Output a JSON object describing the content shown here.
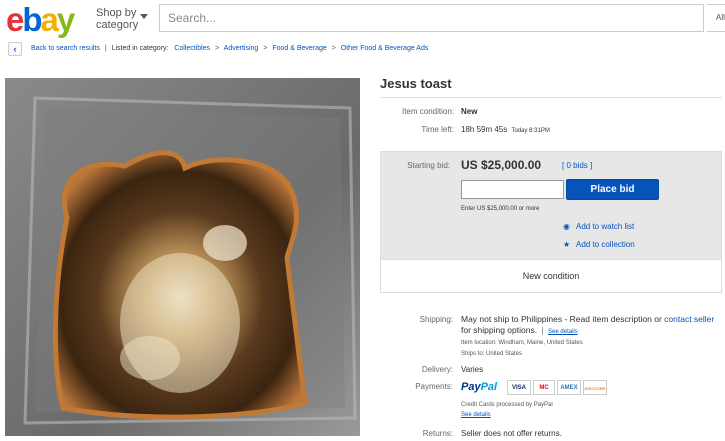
{
  "header": {
    "logo_letters": [
      "e",
      "b",
      "a",
      "y"
    ],
    "logo_colors": [
      "#e53238",
      "#0064d2",
      "#f5af02",
      "#86b817"
    ],
    "shop_by_line1": "Shop by",
    "shop_by_line2": "category",
    "search_placeholder": "Search...",
    "search_category": "All"
  },
  "breadcrumb": {
    "back_icon": "chevron-left-icon",
    "back_label": "Back to search results",
    "separator": "|",
    "listed_label": "Listed in category:",
    "categories": [
      "Collectibles",
      "Advertising",
      "Food & Beverage",
      "Other Food & Beverage Ads"
    ],
    "category_separator": ">"
  },
  "item": {
    "title": "Jesus toast",
    "condition_label": "Item condition:",
    "condition_value": "New",
    "time_left_label": "Time left:",
    "time_left_value": "18h 59m 45s",
    "time_left_end": "Today 8:31PM"
  },
  "bid": {
    "starting_bid_label": "Starting bid:",
    "price": "US $25,000.00",
    "bids_count": "[ 0 bids ]",
    "input_value": "",
    "place_bid_label": "Place bid",
    "enter_note": "Enter US $25,000.00 or more",
    "watch_icon": "eye-icon",
    "watch_label": "Add to watch list",
    "collection_icon": "star-icon",
    "collection_label": "Add to collection",
    "condition_footer": "New condition"
  },
  "shipping": {
    "label": "Shipping:",
    "text_part1": "May not ship to Philippines - Read item description or ",
    "contact_link": "contact seller",
    "text_part2": " for shipping options.",
    "separator": "|",
    "see_details": "See details",
    "location": "Item location:  Windham, Maine, United States",
    "ships_to": "Ships to:  United States"
  },
  "delivery": {
    "label": "Delivery:",
    "value": "Varies"
  },
  "payments": {
    "label": "Payments:",
    "paypal_part1": "Pay",
    "paypal_part2": "Pal",
    "paypal_colors": [
      "#003087",
      "#009cde"
    ],
    "cards": [
      "VISA",
      "MC",
      "AMEX",
      "DISCOVER"
    ],
    "card_colors": [
      "#1a1f71",
      "#eb001b",
      "#2e77bc",
      "#f58220"
    ],
    "note": "Credit Cards processed by PayPal",
    "see_details": "See details"
  },
  "returns": {
    "label": "Returns:",
    "value": "Seller does not offer returns."
  }
}
